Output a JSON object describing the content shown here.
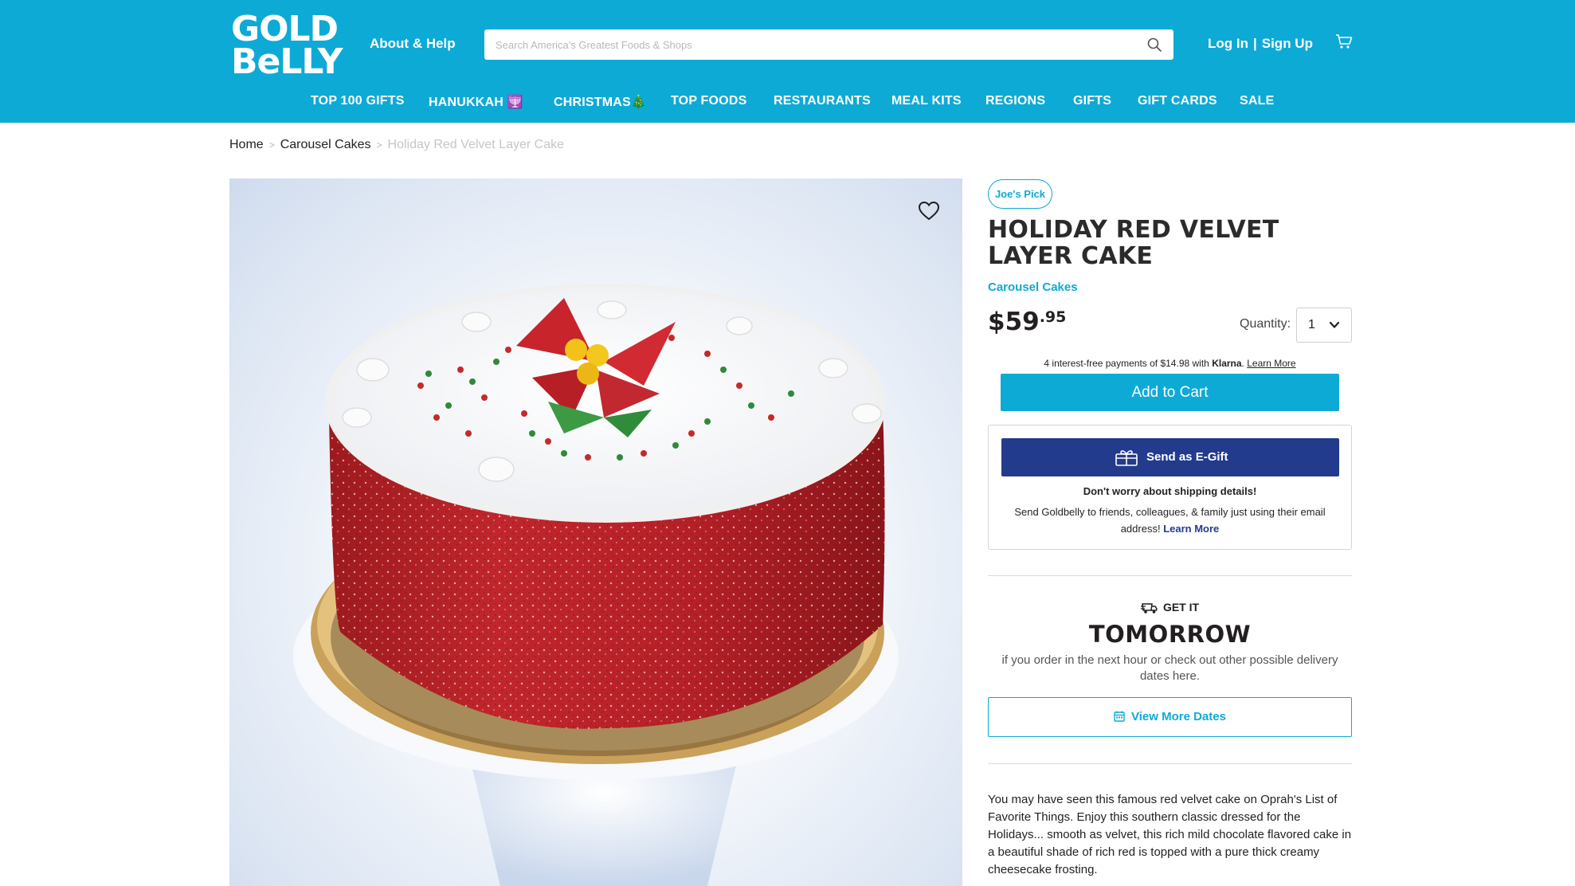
{
  "header": {
    "logo_line1": "GOLD",
    "logo_line2": "BeLLY",
    "about_label": "About & Help",
    "search_placeholder": "Search America's Greatest Foods & Shops",
    "login_label": "Log In",
    "login_separator": "|",
    "signup_label": "Sign Up",
    "colors": {
      "header_bg": "#0eaad6",
      "text": "#ffffff"
    }
  },
  "nav": {
    "items": [
      {
        "label": "TOP 100 GIFTS"
      },
      {
        "label": "HANUKKAH 🕎"
      },
      {
        "label": "CHRISTMAS🎄"
      },
      {
        "label": "TOP FOODS"
      },
      {
        "label": "RESTAURANTS"
      },
      {
        "label": "MEAL KITS"
      },
      {
        "label": "REGIONS"
      },
      {
        "label": "GIFTS"
      },
      {
        "label": "GIFT CARDS"
      },
      {
        "label": "SALE"
      }
    ]
  },
  "breadcrumb": {
    "home": "Home",
    "category": "Carousel Cakes",
    "current": "Holiday Red Velvet Layer Cake",
    "separator": ">"
  },
  "product": {
    "badge": "Joe's Pick",
    "title": "HOLIDAY RED VELVET LAYER CAKE",
    "shop": "Carousel Cakes",
    "price_dollars": "$59",
    "price_cents": ".95",
    "quantity_label": "Quantity:",
    "quantity_value": "1",
    "klarna_text": "4 interest-free payments of $14.98 with",
    "klarna_brand": "Klarna",
    "klarna_dot": ".",
    "klarna_learn": "Learn More",
    "add_to_cart": "Add to Cart",
    "egift_label": "Send as E-Gift",
    "egift_note": "Don't worry about shipping details!",
    "egift_desc": "Send Goldbelly to friends, colleagues, & family just using their email address!",
    "egift_learn": "Learn More",
    "get_it": "GET IT",
    "delivery_day": "TOMORROW",
    "delivery_note": "if you order in the next hour or check out other possible delivery dates here.",
    "view_dates": "View More Dates",
    "description": "You may have seen this famous red velvet cake on Oprah's List of Favorite Things. Enjoy this southern classic dressed for the Holidays... smooth as velvet, this rich mild chocolate flavored cake in a beautiful shade of rich red is topped with a pure thick creamy cheesecake frosting.",
    "colors": {
      "accent": "#0eaad6",
      "egift": "#233b8c",
      "text": "#231f20"
    }
  },
  "icons": [
    "search-icon",
    "cart-icon",
    "heart-icon",
    "chevron-down-icon",
    "gift-icon",
    "truck-icon",
    "calendar-icon"
  ]
}
